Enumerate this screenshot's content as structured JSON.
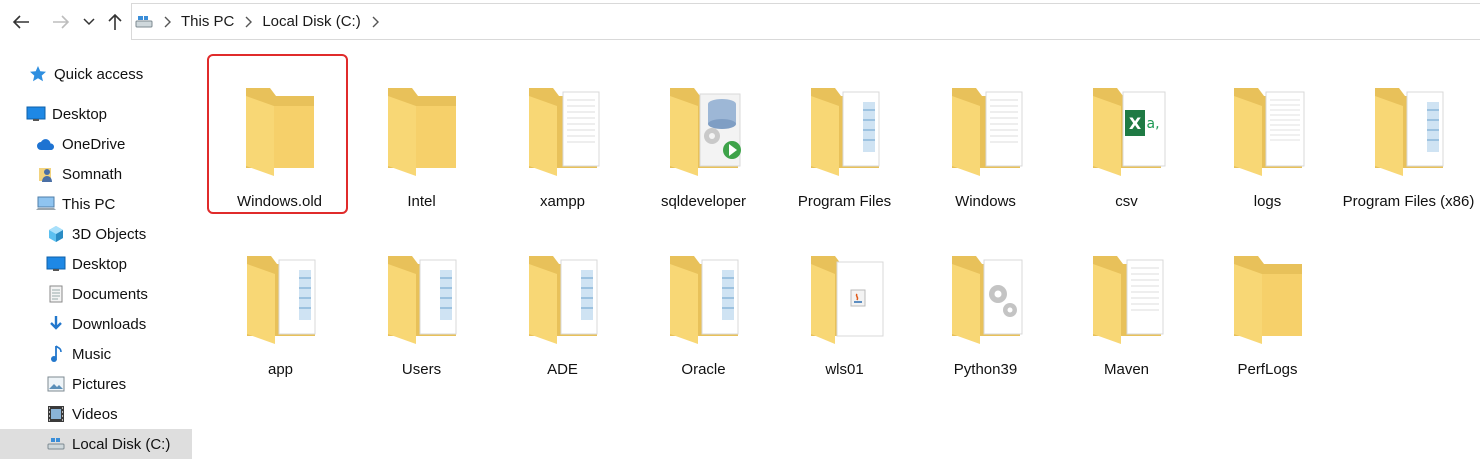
{
  "address_bar": {
    "breadcrumbs": [
      "This PC",
      "Local Disk (C:)"
    ]
  },
  "sidebar": {
    "items": [
      {
        "label": "Quick access",
        "icon": "star-icon"
      },
      {
        "label": "Desktop",
        "icon": "desktop-icon"
      },
      {
        "label": "OneDrive",
        "icon": "cloud-icon"
      },
      {
        "label": "Somnath",
        "icon": "user-icon"
      },
      {
        "label": "This PC",
        "icon": "computer-icon"
      },
      {
        "label": "3D Objects",
        "icon": "cube-icon"
      },
      {
        "label": "Desktop",
        "icon": "desktop-icon"
      },
      {
        "label": "Documents",
        "icon": "documents-icon"
      },
      {
        "label": "Downloads",
        "icon": "download-icon"
      },
      {
        "label": "Music",
        "icon": "music-icon"
      },
      {
        "label": "Pictures",
        "icon": "pictures-icon"
      },
      {
        "label": "Videos",
        "icon": "videos-icon"
      },
      {
        "label": "Local Disk (C:)",
        "icon": "drive-icon"
      }
    ]
  },
  "folders": [
    {
      "name": "Windows.old",
      "icon": "folder-empty-icon"
    },
    {
      "name": "Intel",
      "icon": "folder-empty-icon"
    },
    {
      "name": "xampp",
      "icon": "folder-pages-icon"
    },
    {
      "name": "sqldeveloper",
      "icon": "folder-app-icon"
    },
    {
      "name": "Program Files",
      "icon": "folder-images-icon"
    },
    {
      "name": "Windows",
      "icon": "folder-pages-icon"
    },
    {
      "name": "csv",
      "icon": "folder-excel-icon"
    },
    {
      "name": "logs",
      "icon": "folder-pages-icon"
    },
    {
      "name": "Program Files (x86)",
      "icon": "folder-images-icon"
    },
    {
      "name": "app",
      "icon": "folder-images-icon"
    },
    {
      "name": "Users",
      "icon": "folder-images-icon"
    },
    {
      "name": "ADE",
      "icon": "folder-images-icon"
    },
    {
      "name": "Oracle",
      "icon": "folder-images-icon"
    },
    {
      "name": "wls01",
      "icon": "folder-java-icon"
    },
    {
      "name": "Python39",
      "icon": "folder-gears-icon"
    },
    {
      "name": "Maven",
      "icon": "folder-pages-icon"
    },
    {
      "name": "PerfLogs",
      "icon": "folder-empty-icon"
    }
  ],
  "colors": {
    "folder_back": "#e8c15a",
    "folder_front": "#f8d775",
    "highlight_border": "#e02b2b",
    "selected_bg": "#dedede"
  }
}
